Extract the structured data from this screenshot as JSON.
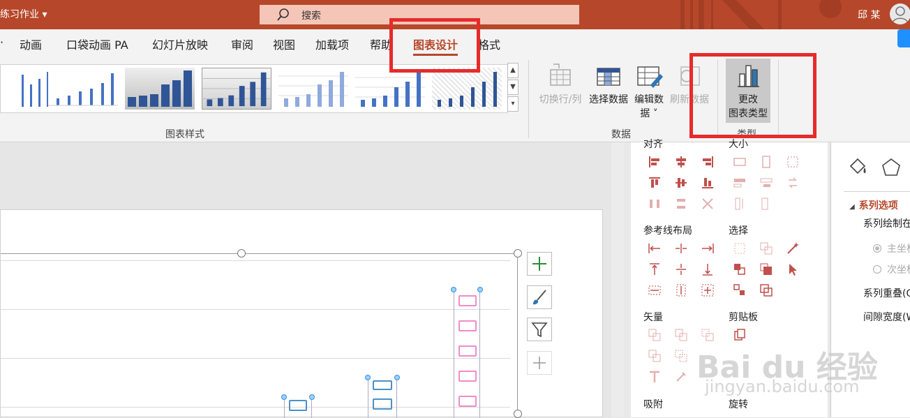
{
  "titlebar": {
    "doc_title": "练习作业 ▾",
    "search_placeholder": "搜索",
    "user_name": "邱 某"
  },
  "tabs": [
    {
      "label": "动画"
    },
    {
      "label": "口袋动画 PA"
    },
    {
      "label": "幻灯片放映"
    },
    {
      "label": "审阅"
    },
    {
      "label": "视图"
    },
    {
      "label": "加载项"
    },
    {
      "label": "帮助"
    },
    {
      "label": "图表设计"
    },
    {
      "label": "格式"
    }
  ],
  "active_tab": "图表设计",
  "ribbon": {
    "styles_group_label": "图表样式",
    "data_group_label": "数据",
    "type_group_label": "类型",
    "buttons": {
      "switch_row_col": "切换行/列",
      "select_data": "选择数据",
      "edit_data_line1": "编辑数",
      "edit_data_line2": "据 ˅",
      "refresh_data": "刷新数据",
      "change_type_line1": "更改",
      "change_type_line2": "图表类型"
    }
  },
  "tools_panel": {
    "align_title": "对齐",
    "size_title": "大小",
    "guides_title": "参考线布局",
    "select_title": "选择",
    "vector_title": "矢量",
    "clipboard_title": "剪贴板",
    "snap_title": "吸附",
    "rotate_title": "旋转"
  },
  "format_panel": {
    "section_title": "系列选项",
    "plot_on": "系列绘制在",
    "primary_axis": "主坐标轴",
    "secondary_axis": "次坐标轴",
    "overlap": "系列重叠(O)",
    "gap_width": "间隙宽度(W)"
  },
  "watermark": {
    "logo": "Bai du 经验",
    "url": "jingyan.baidu.com"
  },
  "colors": {
    "accent": "#b7472a",
    "highlight": "#e62b2b",
    "pink_bar": "#f08cc8",
    "blue_bar": "#4a90c8"
  }
}
